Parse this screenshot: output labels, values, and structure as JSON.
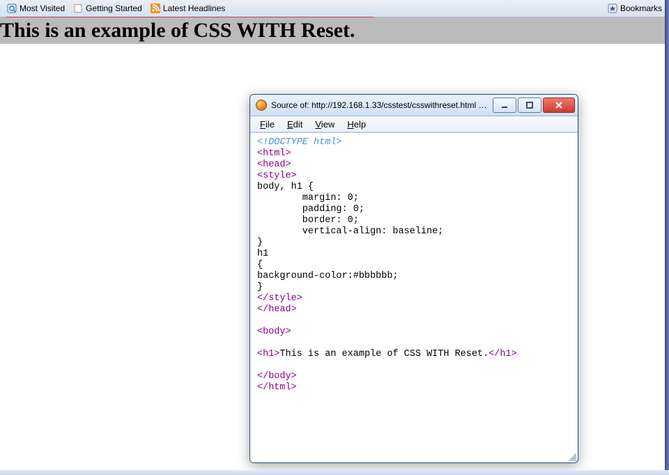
{
  "bookmarksBar": {
    "items": [
      {
        "label": "Most Visited"
      },
      {
        "label": "Getting Started"
      },
      {
        "label": "Latest Headlines"
      }
    ],
    "right": {
      "label": "Bookmarks"
    }
  },
  "page": {
    "heading": "This is an example of CSS WITH Reset."
  },
  "sourceWindow": {
    "title": "Source of: http://192.168.1.33/csstest/csswithreset.html - Mo...",
    "menus": {
      "file": "File",
      "edit": "Edit",
      "view": "View",
      "help": "Help"
    },
    "code": {
      "doctype": "<!DOCTYPE html>",
      "l02a": "<",
      "l02b": "html",
      "l02c": ">",
      "l03a": "<",
      "l03b": "head",
      "l03c": ">",
      "l04a": "<",
      "l04b": "style",
      "l04c": ">",
      "l05": "body, h1 {",
      "l06": "        margin: 0;",
      "l07": "        padding: 0;",
      "l08": "        border: 0;",
      "l09": "        vertical-align: baseline;",
      "l10": "}",
      "l11": "h1",
      "l12": "{",
      "l13": "background-color:#bbbbbb;",
      "l14": "}",
      "l15a": "</",
      "l15b": "style",
      "l15c": ">",
      "l16a": "</",
      "l16b": "head",
      "l16c": ">",
      "l18a": "<",
      "l18b": "body",
      "l18c": ">",
      "l20a": "<",
      "l20b": "h1",
      "l20c": ">",
      "l20text": "This is an example of CSS WITH Reset.",
      "l20d": "</",
      "l20e": "h1",
      "l20f": ">",
      "l22a": "</",
      "l22b": "body",
      "l22c": ">",
      "l23a": "</",
      "l23b": "html",
      "l23c": ">"
    }
  }
}
